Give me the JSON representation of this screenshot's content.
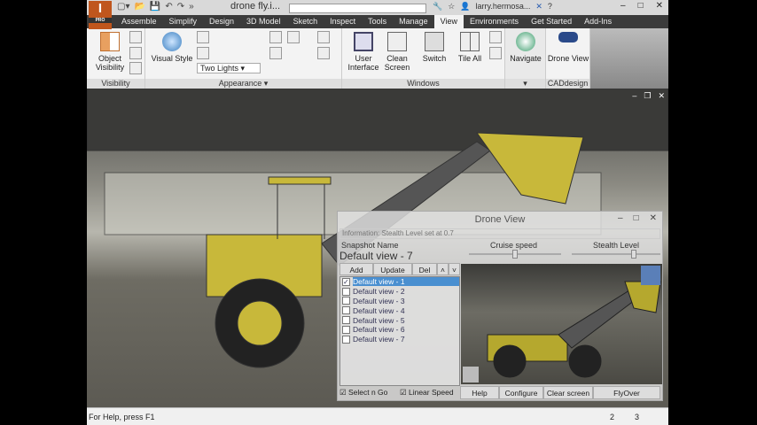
{
  "titlebar": {
    "logo": "I",
    "logo_sub": "PRO",
    "doc_title": "drone fly.i...",
    "user": "larry.hermosa...",
    "help": "?"
  },
  "tabs": [
    "Assemble",
    "Simplify",
    "Design",
    "3D Model",
    "Sketch",
    "Inspect",
    "Tools",
    "Manage",
    "View",
    "Environments",
    "Get Started",
    "Add-Ins"
  ],
  "active_tab": "View",
  "ribbon": {
    "visibility": {
      "label": "Visibility",
      "object_visibility": "Object Visibility"
    },
    "appearance": {
      "label": "Appearance",
      "visual_style": "Visual Style",
      "lighting": "Two Lights"
    },
    "windows": {
      "label": "Windows",
      "user_interface": "User Interface",
      "clean_screen": "Clean Screen",
      "switch": "Switch",
      "tile_all": "Tile All"
    },
    "navigate": {
      "label": "Navigate"
    },
    "caddesign": {
      "label": "CADdesign",
      "drone_view": "Drone View"
    }
  },
  "dialog": {
    "title": "Drone View",
    "info_label": "Information:",
    "info": "Stealth Level set at 0.7",
    "snapshot_label": "Snapshot Name",
    "snapshot_name": "Default view - 7",
    "cruise_label": "Cruise speed",
    "stealth_label": "Stealth Level",
    "cruise_value": 0.5,
    "stealth_value": 0.7,
    "add": "Add",
    "update": "Update",
    "del": "Del",
    "views": [
      {
        "name": "Default view - 1",
        "checked": true
      },
      {
        "name": "Default view - 2"
      },
      {
        "name": "Default view - 3"
      },
      {
        "name": "Default view - 4"
      },
      {
        "name": "Default view - 5"
      },
      {
        "name": "Default view - 6"
      },
      {
        "name": "Default view - 7"
      }
    ],
    "select_n_go": "Select n Go",
    "linear_speed": "Linear Speed",
    "help": "Help",
    "configure": "Configure",
    "clear_screen": "Clear screen",
    "flyover": "FlyOver"
  },
  "status": {
    "help": "For Help, press F1",
    "n1": "2",
    "n2": "3"
  },
  "colors": {
    "accent": "#c0561d",
    "tabbar": "#3b3b3b",
    "loader": "#c8b83a",
    "selection": "#4a8fd0"
  }
}
